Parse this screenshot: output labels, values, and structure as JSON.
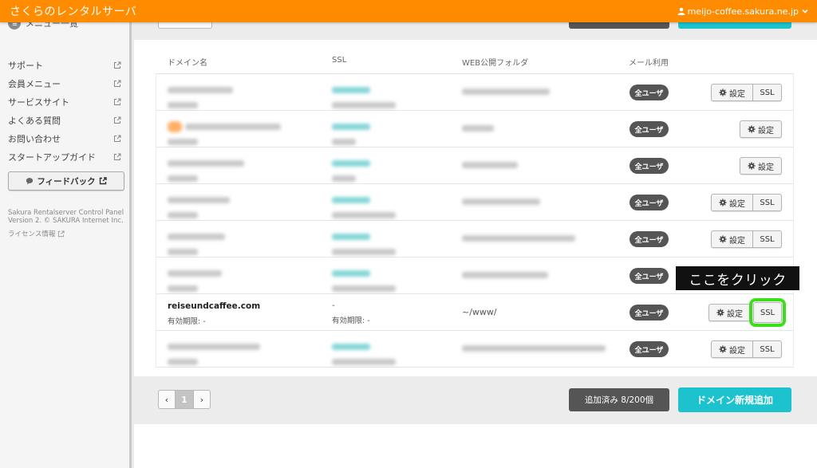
{
  "header": {
    "brand": "さくらのレンタルサーバ",
    "account": "meijo-coffee.sakura.ne.jp"
  },
  "sidebar": {
    "menu_title": "メニュー一覧",
    "items": [
      {
        "label": "サポート"
      },
      {
        "label": "会員メニュー"
      },
      {
        "label": "サービスサイト"
      },
      {
        "label": "よくある質問"
      },
      {
        "label": "お問い合わせ"
      },
      {
        "label": "スタートアップガイド"
      }
    ],
    "feedback": "フィードバック",
    "footer_line1": "Sakura Rentalserver Control Panel",
    "footer_line2": "Version 2. © SAKURA Internet Inc.",
    "license": "ライセンス情報"
  },
  "table": {
    "columns": [
      "ドメイン名",
      "SSL",
      "WEB公開フォルダ",
      "メール利用"
    ],
    "badge_label": "全ユーザ",
    "settings_label": "設定",
    "ssl_label": "SSL",
    "visible_row": {
      "domain": "reiseundcaffee.com",
      "domain_expiry": "有効期限: -",
      "ssl": "-",
      "ssl_expiry": "有効期限: -",
      "web_folder": "~/www/"
    }
  },
  "tooltip": "ここをクリック",
  "footer": {
    "page_current": "1",
    "prev": "‹",
    "next": "›",
    "added_count": "追加済み 8/200個",
    "add_button": "ドメイン新規追加"
  },
  "colors": {
    "header": "#ff8c00",
    "accent_teal": "#1cc3cf",
    "highlight": "#39e01a",
    "badge": "#555555"
  }
}
